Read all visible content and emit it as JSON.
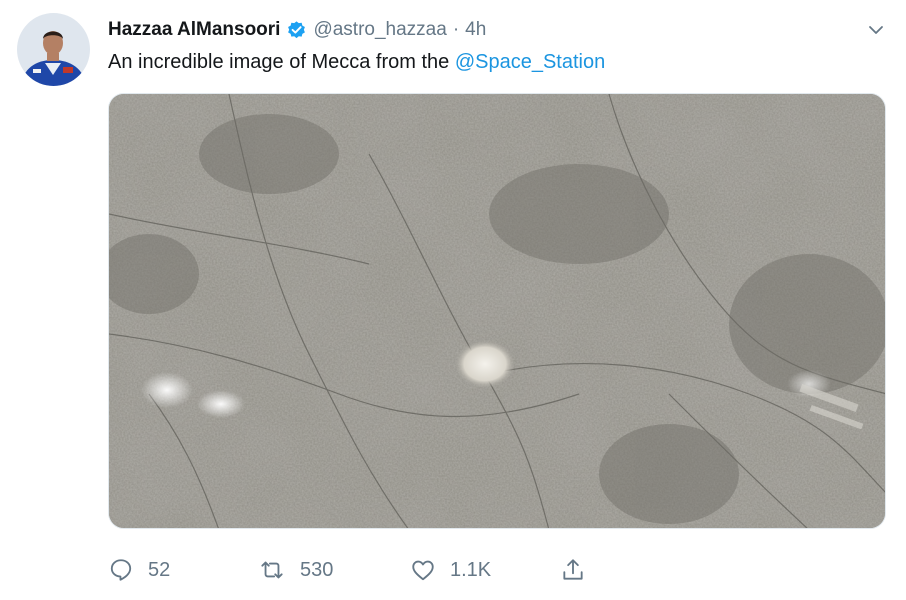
{
  "tweet": {
    "author": {
      "display_name": "Hazzaa AlMansoori",
      "handle": "@astro_hazzaa",
      "separator": "·",
      "time": "4h",
      "verified": true
    },
    "text_before": "An incredible image of Mecca from the ",
    "mention": "@Space_Station",
    "media": {
      "type": "satellite-photo"
    },
    "actions": {
      "reply_count": "52",
      "retweet_count": "530",
      "like_count": "1.1K"
    }
  },
  "colors": {
    "link": "#1b95e0",
    "verified": "#1da1f2",
    "secondary_text": "#657786",
    "primary_text": "#14171a"
  },
  "icons": {
    "reply": "reply-icon",
    "retweet": "retweet-icon",
    "like": "heart-icon",
    "share": "share-icon",
    "caret": "chevron-down-icon",
    "verified": "verified-badge-icon"
  }
}
